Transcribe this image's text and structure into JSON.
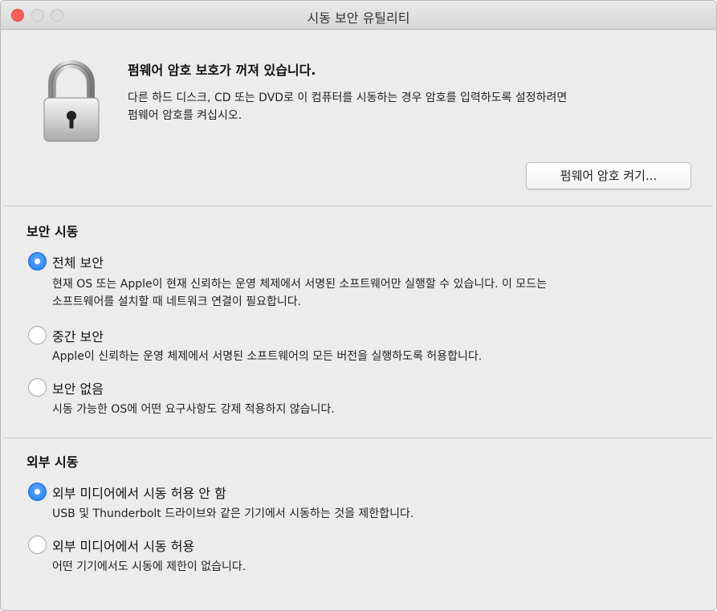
{
  "window": {
    "title": "시동 보안 유틸리티"
  },
  "firmware": {
    "title": "펌웨어 암호 보호가 꺼져 있습니다.",
    "desc_line1": "다른 하드 디스크, CD 또는 DVD로 이 컴퓨터를 시동하는 경우 암호를 입력하도록 설정하려면",
    "desc_line2": "펌웨어 암호를 켜십시오.",
    "button_label": "펌웨어 암호 켜기..."
  },
  "secure_boot": {
    "title": "보안 시동",
    "options": [
      {
        "label": "전체 보안",
        "selected": true,
        "desc_line1": "현재 OS 또는 Apple이 현재 신뢰하는 운영 체제에서 서명된 소프트웨어만 실행할 수 있습니다. 이 모드는",
        "desc_line2": "소프트웨어를 설치할 때 네트워크 연결이 필요합니다."
      },
      {
        "label": "중간 보안",
        "selected": false,
        "desc_line1": "Apple이 신뢰하는 운영 체제에서 서명된 소프트웨어의 모든 버전을 실행하도록 허용합니다."
      },
      {
        "label": "보안 없음",
        "selected": false,
        "desc_line1": "시동 가능한 OS에 어떤 요구사항도 강제 적용하지 않습니다."
      }
    ]
  },
  "external_boot": {
    "title": "외부 시동",
    "options": [
      {
        "label": "외부 미디어에서 시동 허용 안 함",
        "selected": true,
        "desc_line1": "USB 및 Thunderbolt 드라이브와 같은 기기에서 시동하는 것을 제한합니다."
      },
      {
        "label": "외부 미디어에서 시동 허용",
        "selected": false,
        "desc_line1": "어떤 기기에서도 시동에 제한이 없습니다."
      }
    ]
  },
  "colors": {
    "accent": "#1f7bf0",
    "close": "#fc5f57"
  }
}
